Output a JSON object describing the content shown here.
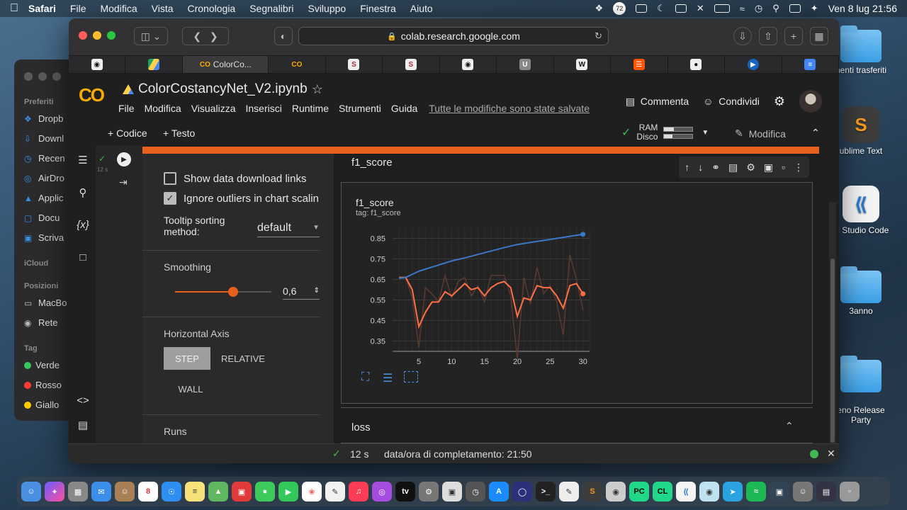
{
  "menubar": {
    "app": "Safari",
    "items": [
      "File",
      "Modifica",
      "Vista",
      "Cronologia",
      "Segnalibri",
      "Sviluppo",
      "Finestra",
      "Aiuto"
    ],
    "clock": "Ven 8 lug  21:56",
    "badge": "72"
  },
  "finder": {
    "sections": {
      "favorites": "Preferiti",
      "icloud": "iCloud",
      "locations": "Posizioni",
      "tags": "Tag"
    },
    "favorites": [
      "Dropb",
      "Downl",
      "Recen",
      "AirDro",
      "Applic",
      "Docu",
      "Scriva"
    ],
    "locations": [
      "MacBo",
      "Rete"
    ],
    "tags": [
      {
        "label": "Verde",
        "color": "#34c759"
      },
      {
        "label": "Rosso",
        "color": "#ff3b30"
      },
      {
        "label": "Giallo",
        "color": "#ffcc00"
      }
    ]
  },
  "desktop": {
    "icons": [
      "nenti trasferiti",
      "ublime Text",
      "al Studio Code",
      "3anno",
      "eno Release\nParty"
    ]
  },
  "browser": {
    "url": "colab.research.google.com",
    "tabs": [
      "",
      "",
      "ColorCo...",
      "",
      "S",
      "S",
      "",
      "U",
      "W",
      "",
      "",
      "",
      ""
    ]
  },
  "colab": {
    "logo": "CO",
    "notebook_title": "ColorCostancyNet_V2.ipynb",
    "menu": [
      "File",
      "Modifica",
      "Visualizza",
      "Inserisci",
      "Runtime",
      "Strumenti",
      "Guida"
    ],
    "saved_status": "Tutte le modifiche sono state salvate",
    "comment_label": "Commenta",
    "share_label": "Condividi",
    "add_code": "+ Codice",
    "add_text": "+ Testo",
    "ram_label": "RAM",
    "disk_label": "Disco",
    "ram_usage": 0.35,
    "disk_usage": 0.3,
    "edit_label": "Modifica",
    "exec_time": "12 s"
  },
  "tensorboard": {
    "show_download_links": "Show data download links",
    "ignore_outliers": "Ignore outliers in chart scalin",
    "tooltip_label": "Tooltip sorting\nmethod:",
    "tooltip_value": "default",
    "smoothing_label": "Smoothing",
    "smoothing_value": "0,6",
    "smoothing": 0.6,
    "horizontal_axis_label": "Horizontal Axis",
    "axis_options": [
      "STEP",
      "RELATIVE",
      "WALL"
    ],
    "runs_label": "Runs",
    "section1": "f1_score",
    "section2": "loss",
    "chart_title": "f1_score",
    "chart_tag": "tag: f1_score"
  },
  "statusbar": {
    "time": "12 s",
    "completed": "data/ora di completamento: 21:50"
  },
  "chart_data": {
    "type": "line",
    "title": "f1_score",
    "subtitle": "tag: f1_score",
    "xlabel": "",
    "ylabel": "",
    "xlim": [
      1,
      31
    ],
    "ylim": [
      0.3,
      0.9
    ],
    "x_ticks": [
      5,
      10,
      15,
      20,
      25,
      30
    ],
    "y_ticks": [
      0.35,
      0.45,
      0.55,
      0.65,
      0.75,
      0.85
    ],
    "grid": true,
    "series": [
      {
        "name": "",
        "color": "#3a78c8",
        "x": [
          2,
          3,
          4,
          5,
          6,
          8,
          10,
          12,
          15,
          18,
          20,
          22,
          25,
          28,
          30
        ],
        "values": [
          0.655,
          0.66,
          0.675,
          0.69,
          0.7,
          0.72,
          0.74,
          0.755,
          0.78,
          0.805,
          0.82,
          0.83,
          0.845,
          0.86,
          0.87
        ]
      },
      {
        "name": "",
        "color": "#ff7043",
        "x": [
          2,
          3,
          4,
          5,
          6,
          7,
          8,
          9,
          10,
          11,
          12,
          13,
          14,
          15,
          16,
          17,
          18,
          19,
          20,
          21,
          22,
          23,
          24,
          25,
          26,
          27,
          28,
          29,
          30
        ],
        "values": [
          0.66,
          0.66,
          0.6,
          0.42,
          0.49,
          0.54,
          0.54,
          0.59,
          0.57,
          0.6,
          0.63,
          0.6,
          0.61,
          0.57,
          0.61,
          0.63,
          0.64,
          0.61,
          0.47,
          0.56,
          0.55,
          0.62,
          0.61,
          0.61,
          0.57,
          0.51,
          0.62,
          0.63,
          0.58
        ]
      },
      {
        "name": "",
        "color": "#5a3a30",
        "x": [
          2,
          3,
          4,
          5,
          6,
          7,
          8,
          9,
          10,
          11,
          12,
          13,
          14,
          15,
          16,
          17,
          18,
          19,
          20,
          21,
          22,
          23,
          24,
          25,
          26,
          27,
          28,
          29,
          30
        ],
        "values": [
          0.66,
          0.66,
          0.56,
          0.32,
          0.61,
          0.58,
          0.54,
          0.67,
          0.56,
          0.64,
          0.66,
          0.57,
          0.62,
          0.54,
          0.67,
          0.67,
          0.67,
          0.57,
          0.26,
          0.66,
          0.53,
          0.71,
          0.58,
          0.62,
          0.54,
          0.38,
          0.77,
          0.65,
          0.5
        ]
      }
    ]
  }
}
